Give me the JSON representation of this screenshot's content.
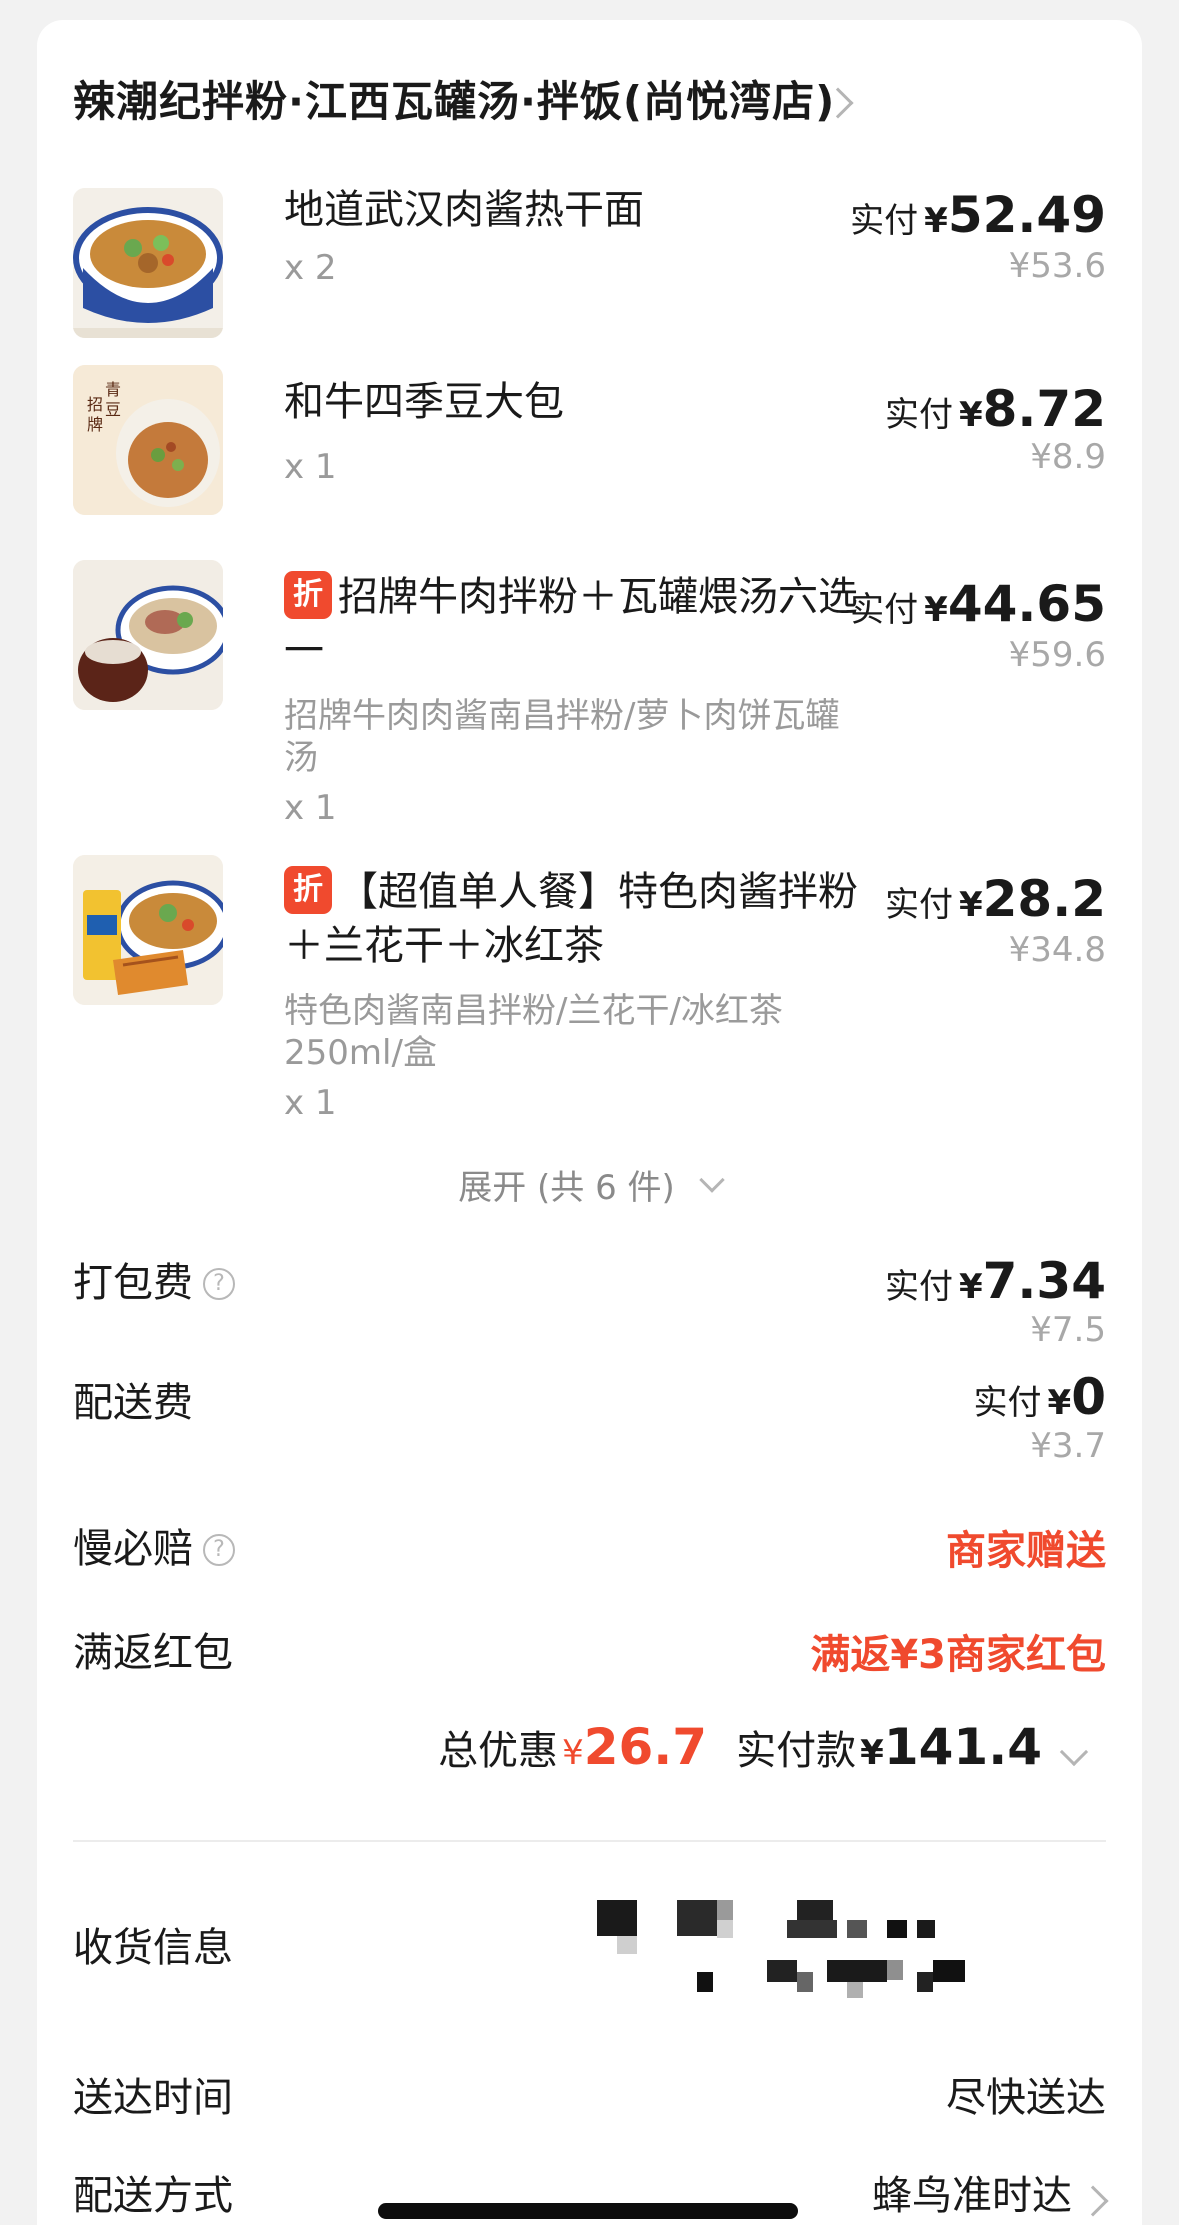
{
  "store": {
    "name": "辣潮纪拌粉·江西瓦罐汤·拌饭(尚悦湾店)"
  },
  "items": [
    {
      "name": "地道武汉肉酱热干面",
      "name_cont": "",
      "has_discount": false,
      "desc": [],
      "qty": "x 2",
      "paid_label": "实付",
      "currency": "¥",
      "paid": "52.49",
      "original": "¥53.6"
    },
    {
      "name": "和牛四季豆大包",
      "name_cont": "",
      "has_discount": false,
      "desc": [],
      "qty": "x 1",
      "paid_label": "实付",
      "currency": "¥",
      "paid": "8.72",
      "original": "¥8.9"
    },
    {
      "name": "招牌牛肉拌粉＋瓦罐煨汤六选",
      "name_cont": "一",
      "has_discount": true,
      "badge": "折",
      "desc": [
        "招牌牛肉肉酱南昌拌粉/萝卜肉饼瓦罐",
        "汤"
      ],
      "qty": "x 1",
      "paid_label": "实付",
      "currency": "¥",
      "paid": "44.65",
      "original": "¥59.6"
    },
    {
      "name": "【超值单人餐】特色肉酱拌粉",
      "name_cont": "＋兰花干＋冰红茶",
      "has_discount": true,
      "badge": "折",
      "desc": [
        "特色肉酱南昌拌粉/兰花干/冰红茶",
        "250ml/盒"
      ],
      "qty": "x 1",
      "paid_label": "实付",
      "currency": "¥",
      "paid": "28.2",
      "original": "¥34.8"
    }
  ],
  "expand": {
    "label": "展开 (共 6 件)"
  },
  "fees": {
    "packing": {
      "label": "打包费",
      "help": "?",
      "paid_label": "实付",
      "currency": "¥",
      "paid": "7.34",
      "original": "¥7.5"
    },
    "delivery": {
      "label": "配送费",
      "paid_label": "实付",
      "currency": "¥",
      "paid": "0",
      "original": "¥3.7"
    }
  },
  "guarantee": {
    "label": "慢必赔",
    "help": "?",
    "value": "商家赠送"
  },
  "redpacket": {
    "label": "满返红包",
    "value": "满返¥3商家红包"
  },
  "total": {
    "discount_label": "总优惠",
    "currency": "¥",
    "discount": "26.7",
    "paid_label": "实付款",
    "paid": "141.4"
  },
  "delivery_info": {
    "address_label": "收货信息",
    "time_label": "送达时间",
    "time_value": "尽快送达",
    "method_label": "配送方式",
    "method_value": "蜂鸟准时达"
  },
  "colors": {
    "accent": "#f04a2e",
    "muted": "#9a9a9a",
    "background": "#f2f2f2"
  }
}
